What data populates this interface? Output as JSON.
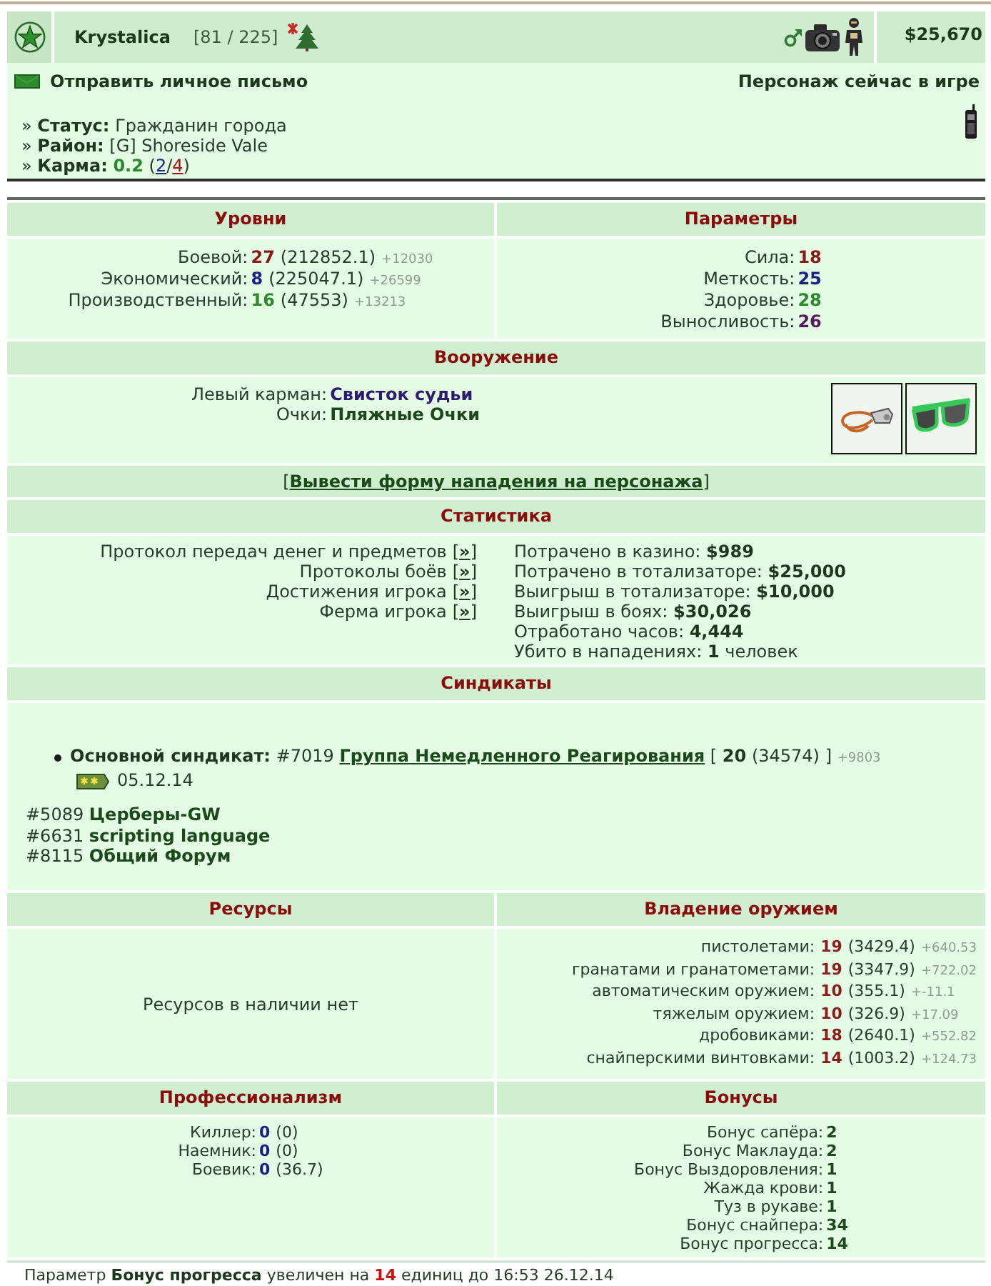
{
  "profile": {
    "name": "Krystalica",
    "count": "[81 / 225]",
    "money": "$25,670"
  },
  "contact": {
    "message_link": "Отправить личное письмо",
    "online_status": "Персонаж сейчас в игре"
  },
  "info": [
    {
      "marker": "»",
      "label": "Статус:",
      "value": "Гражданин города"
    },
    {
      "marker": "»",
      "label": "Район:",
      "value": "[G] Shoreside Vale"
    }
  ],
  "karma": {
    "marker": "»",
    "label": "Карма:",
    "parts": [
      {
        "kind": "score",
        "text": "0.2"
      },
      {
        "kind": "plain",
        "text": " ("
      },
      {
        "kind": "link_positive",
        "text": "2"
      },
      {
        "kind": "plain",
        "text": "/"
      },
      {
        "kind": "link_negative",
        "text": "4"
      },
      {
        "kind": "plain",
        "text": ")"
      }
    ]
  },
  "levels": {
    "title": "Уровни",
    "items": [
      {
        "label": "Боевой:",
        "value": "27",
        "exp": "(212852.1)",
        "delta": "+12030",
        "color": "#8b1a1a"
      },
      {
        "label": "Экономический:",
        "value": "8",
        "exp": "(225047.1)",
        "delta": "+26599",
        "color": "#1a2080"
      },
      {
        "label": "Производственный:",
        "value": "16",
        "exp": "(47553)",
        "delta": "+13213",
        "color": "#2a8a2a"
      }
    ]
  },
  "parameters": {
    "title": "Параметры",
    "items": [
      {
        "label": "Сила:",
        "value": "18",
        "color": "#8b1a1a"
      },
      {
        "label": "Меткость:",
        "value": "25",
        "color": "#1a2080"
      },
      {
        "label": "Здоровье:",
        "value": "28",
        "color": "#2a8a2a"
      },
      {
        "label": "Выносливость:",
        "value": "26",
        "color": "#561a5e"
      }
    ]
  },
  "armament": {
    "title": "Вооружение",
    "items": [
      {
        "label": "Левый карман:",
        "value": "Свисток судьи",
        "color": "#2e1a6e"
      },
      {
        "label": "Очки:",
        "value": "Пляжные Очки",
        "color": "#1a4a1a"
      }
    ]
  },
  "attack": {
    "open": "[",
    "link": "Вывести форму нападения на персонажа",
    "close": "]"
  },
  "statistics": {
    "title": "Статистика",
    "links": [
      {
        "label": "Протокол передач денег и предметов",
        "open": "[",
        "arrow": "»",
        "close": "]"
      },
      {
        "label": "Протоколы боёв",
        "open": "[",
        "arrow": "»",
        "close": "]"
      },
      {
        "label": "Достижения игрока",
        "open": "[",
        "arrow": "»",
        "close": "]"
      },
      {
        "label": "Ферма игрока",
        "open": "[",
        "arrow": "»",
        "close": "]"
      }
    ],
    "figures": [
      {
        "label": "Потрачено в казино:",
        "value": "$989"
      },
      {
        "label": "Потрачено в тотализаторе:",
        "value": "$25,000"
      },
      {
        "label": "Выигрыш в тотализаторе:",
        "value": "$10,000"
      },
      {
        "label": "Выигрыш в боях:",
        "value": "$30,026"
      },
      {
        "label": "Отработано часов:",
        "value": "4,444"
      },
      {
        "label": "Убито в нападениях:",
        "value": "1",
        "suffix": "человек"
      }
    ]
  },
  "syndicates": {
    "title": "Синдикаты",
    "main": {
      "label": "Основной синдикат:",
      "number": "#7019",
      "name": "Группа Немедленного Реагирования",
      "open": "[",
      "rank": "20",
      "points": "(34574)",
      "close": "]",
      "delta": "+9803",
      "date": "05.12.14"
    },
    "others": [
      {
        "number": "#5089",
        "name": "Церберы-GW"
      },
      {
        "number": "#6631",
        "name": "scripting language"
      },
      {
        "number": "#8115",
        "name": "Общий Форум"
      }
    ]
  },
  "resources": {
    "title": "Ресурсы",
    "empty_text": "Ресурсов в наличии нет"
  },
  "weapon_skills": {
    "title": "Владение оружием",
    "items": [
      {
        "label": "пистолетами:",
        "value": "19",
        "exp": "(3429.4)",
        "delta": "+640.53"
      },
      {
        "label": "гранатами и гранатометами:",
        "value": "19",
        "exp": "(3347.9)",
        "delta": "+722.02"
      },
      {
        "label": "автоматическим оружием:",
        "value": "10",
        "exp": "(355.1)",
        "delta": "+-11.1"
      },
      {
        "label": "тяжелым оружием:",
        "value": "10",
        "exp": "(326.9)",
        "delta": "+17.09"
      },
      {
        "label": "дробовиками:",
        "value": "18",
        "exp": "(2640.1)",
        "delta": "+552.82"
      },
      {
        "label": "снайперскими винтовками:",
        "value": "14",
        "exp": "(1003.2)",
        "delta": "+124.73"
      }
    ]
  },
  "professionalism": {
    "title": "Профессионализм",
    "items": [
      {
        "label": "Киллер:",
        "value": "0",
        "exp": "(0)"
      },
      {
        "label": "Наемник:",
        "value": "0",
        "exp": "(0)"
      },
      {
        "label": "Боевик:",
        "value": "0",
        "exp": "(36.7)"
      }
    ]
  },
  "bonuses": {
    "title": "Бонусы",
    "items": [
      {
        "label": "Бонус сапёра:",
        "value": "2"
      },
      {
        "label": "Бонус Маклауда:",
        "value": "2"
      },
      {
        "label": "Бонус Выздоровления:",
        "value": "1"
      },
      {
        "label": "Жажда крови:",
        "value": "1"
      },
      {
        "label": "Туз в рукаве:",
        "value": "1"
      },
      {
        "label": "Бонус снайпера:",
        "value": "34"
      },
      {
        "label": "Бонус прогресса:",
        "value": "14"
      }
    ]
  },
  "notice": {
    "parts": [
      {
        "kind": "plain",
        "text": "Параметр "
      },
      {
        "kind": "bold",
        "text": "Бонус прогресса"
      },
      {
        "kind": "plain",
        "text": " увеличен на "
      },
      {
        "kind": "number",
        "text": "14"
      },
      {
        "kind": "plain",
        "text": " единиц до 16:53 26.12.14"
      }
    ]
  }
}
